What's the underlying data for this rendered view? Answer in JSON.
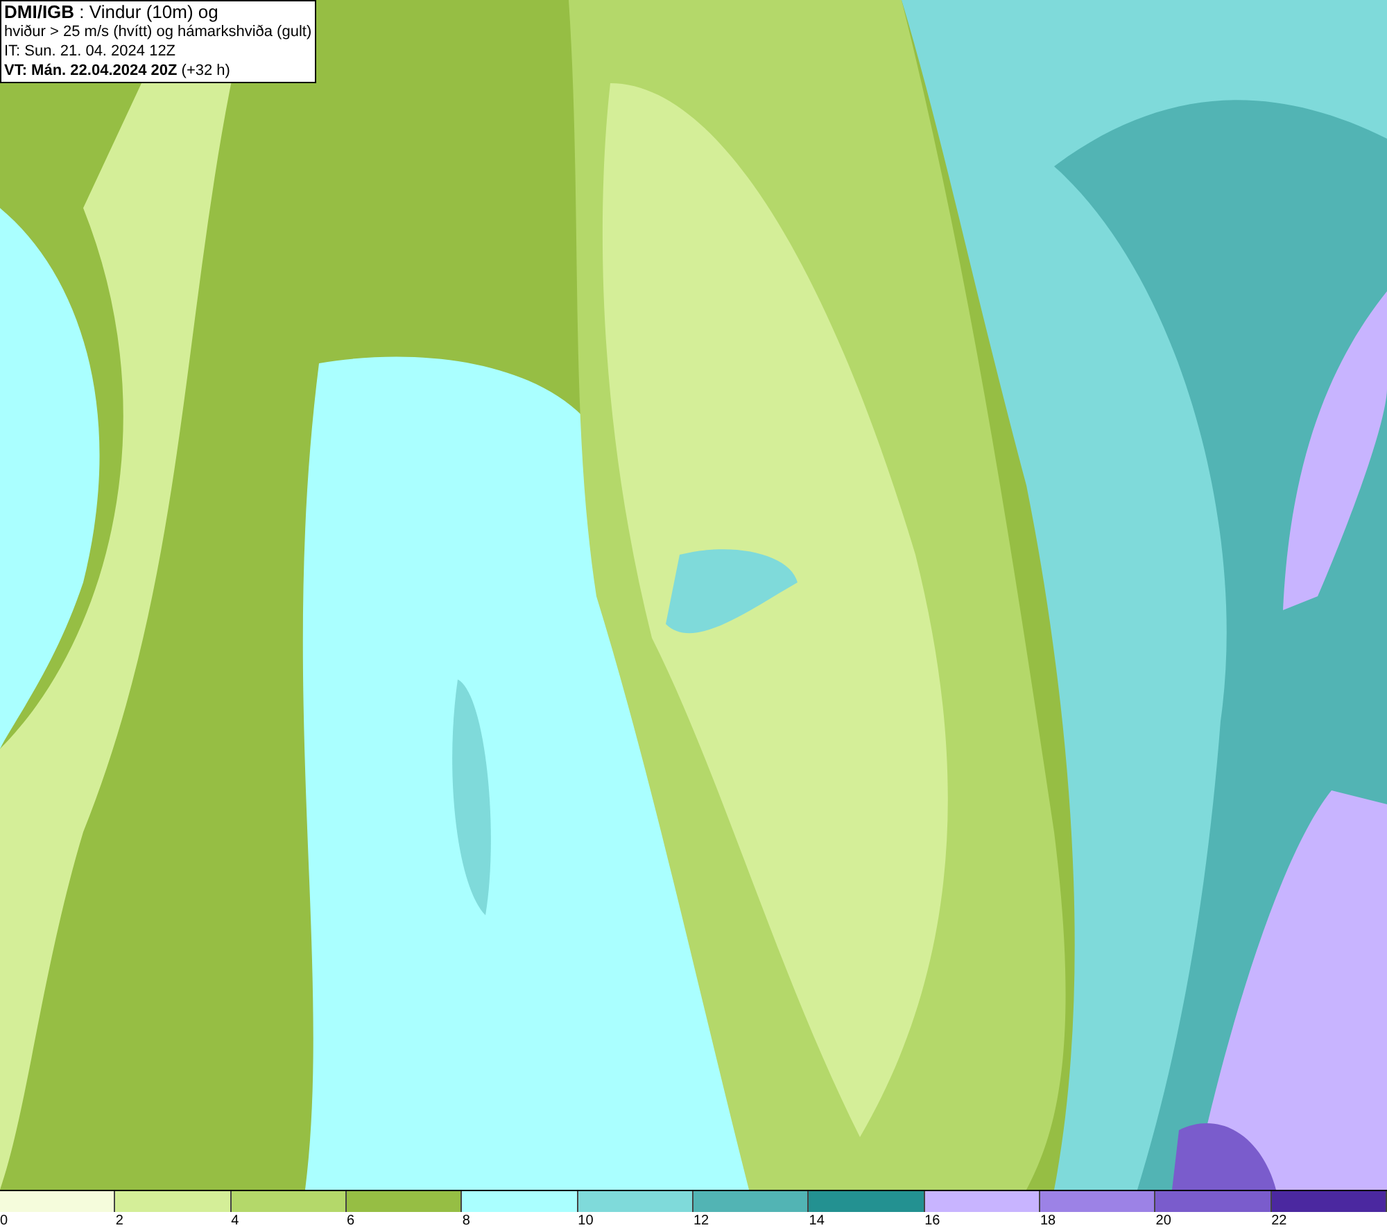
{
  "header": {
    "lines": [
      "**DMI/IGB** : Vindur (10m) og",
      "hviður > 25 m/s (hvítt) og hámarkshviða (gult)",
      "IT: Sun. 21. 04. 2024 12Z",
      "**VT: Mán. 22.04.2024 20Z** (+32 h)"
    ]
  },
  "legend": {
    "segments": [
      {
        "color": "#f5fcdc"
      },
      {
        "color": "#d4ee98"
      },
      {
        "color": "#b4d86a"
      },
      {
        "color": "#96be44"
      },
      {
        "color": "#aaffff"
      },
      {
        "color": "#7fdada"
      },
      {
        "color": "#52b4b4"
      },
      {
        "color": "#239191"
      },
      {
        "color": "#c8b4ff"
      },
      {
        "color": "#9c82e6"
      },
      {
        "color": "#7a5ccc"
      },
      {
        "color": "#4b28a0"
      }
    ],
    "ticks": [
      "0",
      "2",
      "4",
      "6",
      "8",
      "10",
      "12",
      "14",
      "16",
      "18",
      "20",
      "22"
    ]
  }
}
